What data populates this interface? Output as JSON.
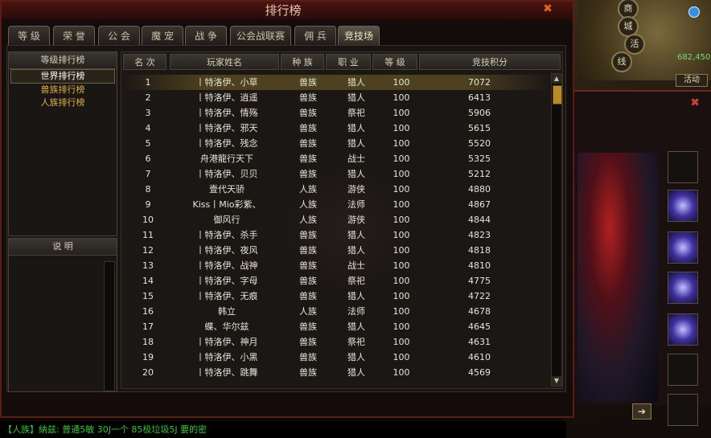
{
  "window": {
    "title": "排行榜"
  },
  "tabs": [
    "等 级",
    "荣 誉",
    "公 会",
    "魔 宠",
    "战 争",
    "公会战联赛",
    "佣 兵",
    "竞技场"
  ],
  "active_tab": 7,
  "left": {
    "header": "等级排行榜",
    "items": [
      "世界排行榜",
      "兽族排行榜",
      "人族排行榜"
    ],
    "selected": 0,
    "desc_header": "说  明"
  },
  "table": {
    "headers": [
      "名 次",
      "玩家姓名",
      "种 族",
      "职 业",
      "等 级",
      "竞技积分"
    ],
    "rows": [
      [
        "1",
        "丨特洛伊、小草",
        "兽族",
        "猎人",
        "100",
        "7072"
      ],
      [
        "2",
        "丨特洛伊、逍遥",
        "兽族",
        "猎人",
        "100",
        "6413"
      ],
      [
        "3",
        "丨特洛伊、情殇",
        "兽族",
        "祭祀",
        "100",
        "5906"
      ],
      [
        "4",
        "丨特洛伊、邪天",
        "兽族",
        "猎人",
        "100",
        "5615"
      ],
      [
        "5",
        "丨特洛伊、残念",
        "兽族",
        "猎人",
        "100",
        "5520"
      ],
      [
        "6",
        "舟港龍行天下",
        "兽族",
        "战士",
        "100",
        "5325"
      ],
      [
        "7",
        "丨特洛伊、贝贝",
        "兽族",
        "猎人",
        "100",
        "5212"
      ],
      [
        "8",
        "壹代天骄",
        "人族",
        "游侠",
        "100",
        "4880"
      ],
      [
        "9",
        "Kiss丨Mio彩紫、",
        "人族",
        "法师",
        "100",
        "4867"
      ],
      [
        "10",
        "御风行",
        "人族",
        "游侠",
        "100",
        "4844"
      ],
      [
        "11",
        "丨特洛伊、杀手",
        "兽族",
        "猎人",
        "100",
        "4823"
      ],
      [
        "12",
        "丨特洛伊、夜风",
        "兽族",
        "猎人",
        "100",
        "4818"
      ],
      [
        "13",
        "丨特洛伊、战神",
        "兽族",
        "战士",
        "100",
        "4810"
      ],
      [
        "14",
        "丨特洛伊、字母",
        "兽族",
        "祭祀",
        "100",
        "4775"
      ],
      [
        "15",
        "丨特洛伊、无痕",
        "兽族",
        "猎人",
        "100",
        "4722"
      ],
      [
        "16",
        "韩立",
        "人族",
        "法师",
        "100",
        "4678"
      ],
      [
        "17",
        "蝶、华尔兹",
        "兽族",
        "猎人",
        "100",
        "4645"
      ],
      [
        "18",
        "丨特洛伊、神月",
        "兽族",
        "祭祀",
        "100",
        "4631"
      ],
      [
        "19",
        "丨特洛伊、小黑",
        "兽族",
        "猎人",
        "100",
        "4610"
      ],
      [
        "20",
        "丨特洛伊、跳舞",
        "兽族",
        "猎人",
        "100",
        "4569"
      ]
    ]
  },
  "minimap": {
    "buttons": [
      "商",
      "城",
      "活",
      "线"
    ],
    "coords": "682,450",
    "tag": "活动"
  },
  "chat": {
    "text": "【人族】納兹: 普通5敏 30J一个   85极垃圾5J 要的密"
  }
}
